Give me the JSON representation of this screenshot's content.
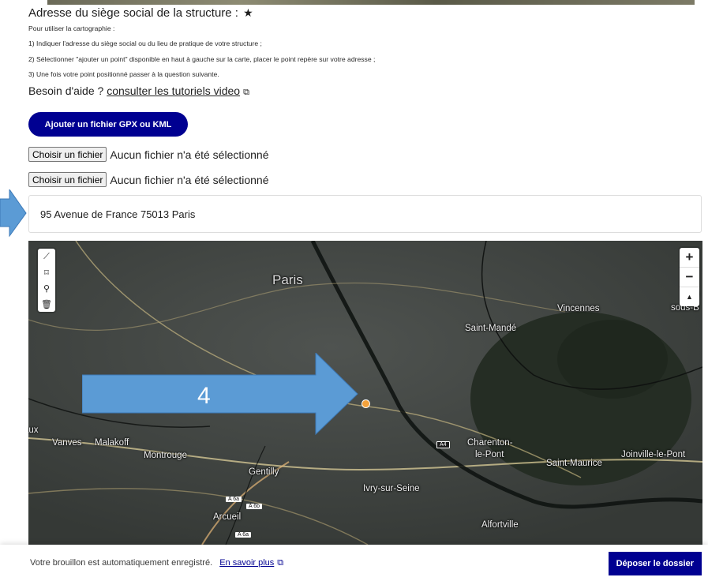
{
  "section": {
    "title": "Adresse du siège social de la structure :",
    "required_mark": "★",
    "hints": [
      "Pour utiliser la cartographie :",
      "1) Indiquer l'adresse du siège social ou du lieu de pratique de votre structure ;",
      "2) Sélectionner \"ajouter un point\" disponible en haut à gauche sur la carte, placer le point repère sur votre adresse ;",
      "3) Une fois votre point positionné passer à la question suivante."
    ],
    "help_prefix": "Besoin d'aide ?",
    "help_link": "consulter les tutoriels video"
  },
  "gpx_button": "Ajouter un fichier GPX ou KML",
  "file_inputs": [
    {
      "button": "Choisir un fichier",
      "status": "Aucun fichier n'a été sélectionné"
    },
    {
      "button": "Choisir un fichier",
      "status": "Aucun fichier n'a été sélectionné"
    }
  ],
  "address_value": "95 Avenue de France 75013 Paris",
  "map": {
    "places": {
      "paris": "Paris",
      "vincennes": "Vincennes",
      "saint_mande": "Saint-Mandé",
      "fontenay": "Fo",
      "fontenay2": "sous-B",
      "vanves": "Vanves",
      "malakoff": "Malakoff",
      "montrouge": "Montrouge",
      "gentilly": "Gentilly",
      "ivry": "Ivry-sur-Seine",
      "charenton": "Charenton-",
      "charenton2": "le-Pont",
      "saint_maurice": "Saint-Maurice",
      "joinville": "Joinville-le-Pont",
      "arcueil": "Arcueil",
      "alfortville": "Alfortville",
      "aux": "aux"
    },
    "road_shields": [
      "A 6a",
      "A 6b",
      "A 6a",
      "A4"
    ],
    "zoom_in": "+",
    "zoom_out": "−",
    "compass": "▲",
    "annotation_number": "4",
    "tools": [
      "line-tool-icon",
      "polygon-tool-icon",
      "marker-tool-icon",
      "trash-icon"
    ]
  },
  "footer": {
    "autosave_text": "Votre brouillon est automatiquement enregistré.",
    "learn_more": "En savoir plus",
    "submit": "Déposer le dossier"
  },
  "colors": {
    "primary": "#000091",
    "marker": "#f4a23c",
    "annotation_arrow": "#5b9bd5"
  }
}
